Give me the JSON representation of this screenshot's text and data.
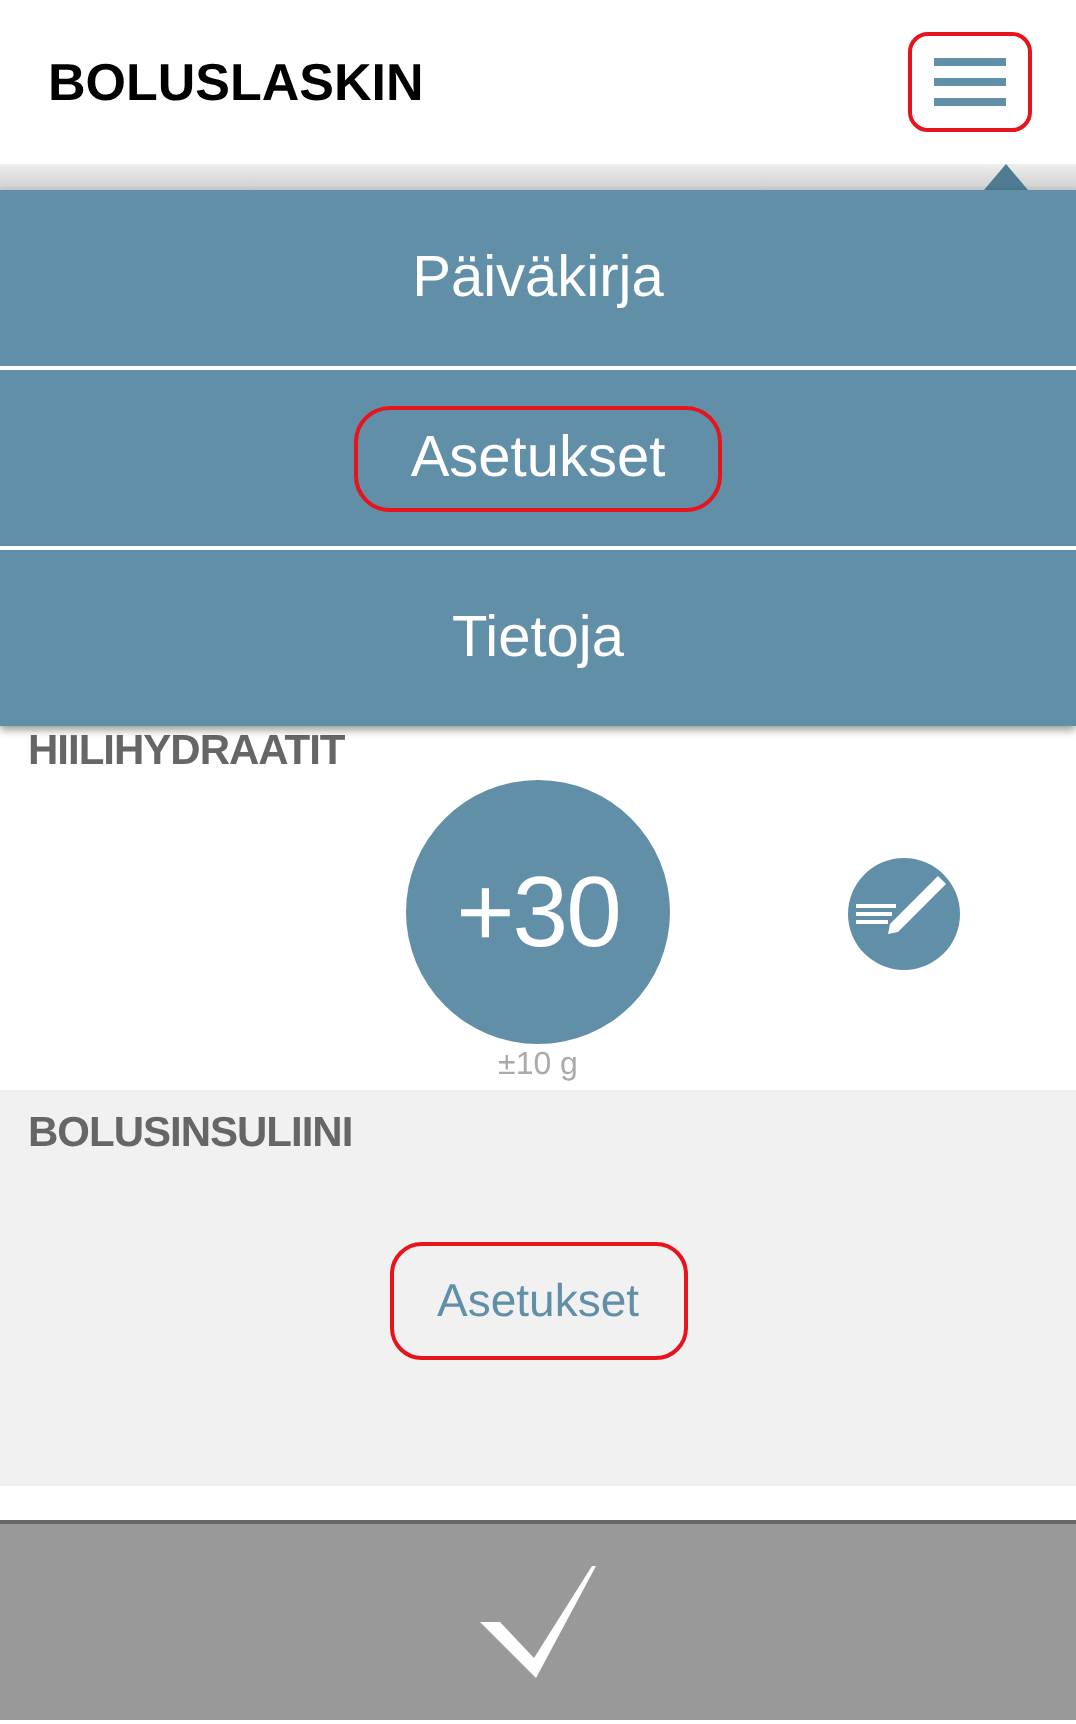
{
  "header": {
    "title": "BOLUSLASKIN",
    "menu_button": {
      "highlighted": true
    }
  },
  "menu": {
    "items": [
      {
        "label": "Päiväkirja",
        "highlighted": false
      },
      {
        "label": "Asetukset",
        "highlighted": true
      },
      {
        "label": "Tietoja",
        "highlighted": false
      }
    ]
  },
  "carbohydrates": {
    "heading": "HIILIHYDRAATIT",
    "amount": "+30",
    "step": "±10 g"
  },
  "bolus_insulin": {
    "heading": "BOLUSINSULIINI",
    "link": {
      "label": "Asetukset",
      "highlighted": true
    }
  },
  "confirm_bar": {
    "kind": "check"
  }
}
